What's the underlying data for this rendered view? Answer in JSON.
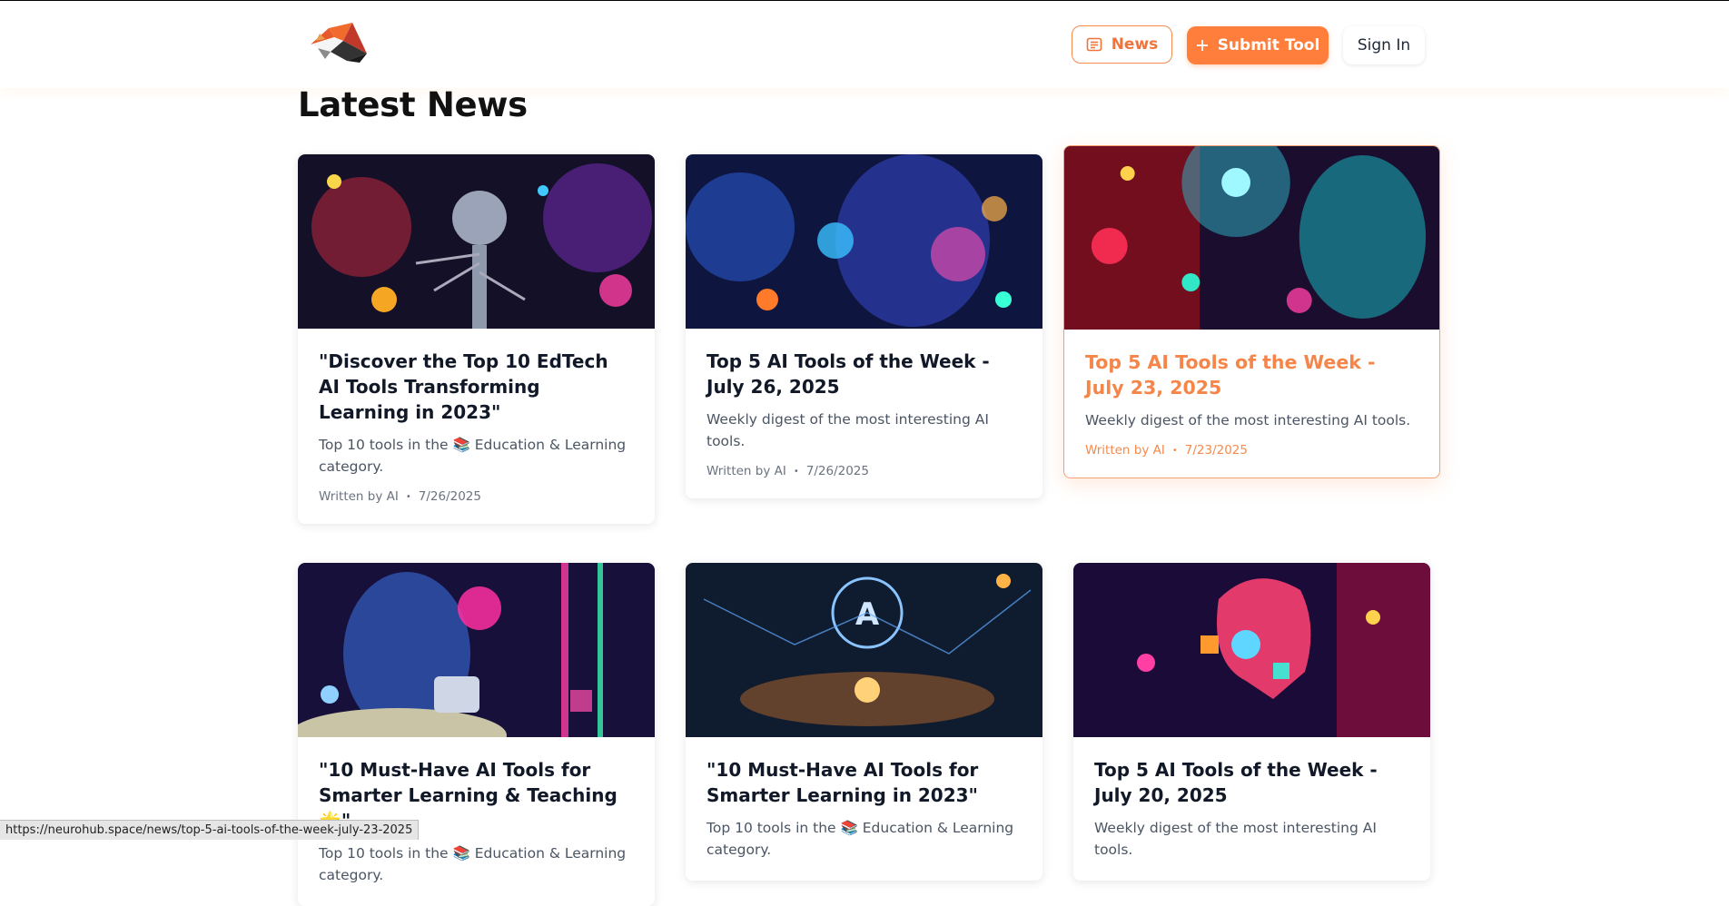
{
  "header": {
    "logo_alt": "fox logo",
    "news_label": "News",
    "submit_label": "Submit Tool",
    "signin_label": "Sign In",
    "accent": "#ff7e3c"
  },
  "page_title": "Latest News",
  "cards": [
    {
      "title": "\"Discover the Top 10 EdTech AI Tools Transforming Learning in 2023\"",
      "desc": "Top 10 tools in the 📚 Education & Learning category.",
      "author": "Written by AI",
      "date": "7/26/2025"
    },
    {
      "title": "Top 5 AI Tools of the Week - July 26, 2025",
      "desc": "Weekly digest of the most interesting AI tools.",
      "author": "Written by AI",
      "date": "7/26/2025"
    },
    {
      "title": "Top 5 AI Tools of the Week - July 23, 2025",
      "desc": "Weekly digest of the most interesting AI tools.",
      "author": "Written by AI",
      "date": "7/23/2025"
    },
    {
      "title": "\"10 Must-Have AI Tools for Smarter Learning & Teaching 🌟\"",
      "desc": "Top 10 tools in the 📚 Education & Learning category."
    },
    {
      "title": "\"10 Must-Have AI Tools for Smarter Learning in 2023\"",
      "desc": "Top 10 tools in the 📚 Education & Learning category."
    },
    {
      "title": "Top 5 AI Tools of the Week - July 20, 2025",
      "desc": "Weekly digest of the most interesting AI tools."
    }
  ],
  "bullet": "•",
  "statusbar": "https://neurohub.space/news/top-5-ai-tools-of-the-week-july-23-2025"
}
